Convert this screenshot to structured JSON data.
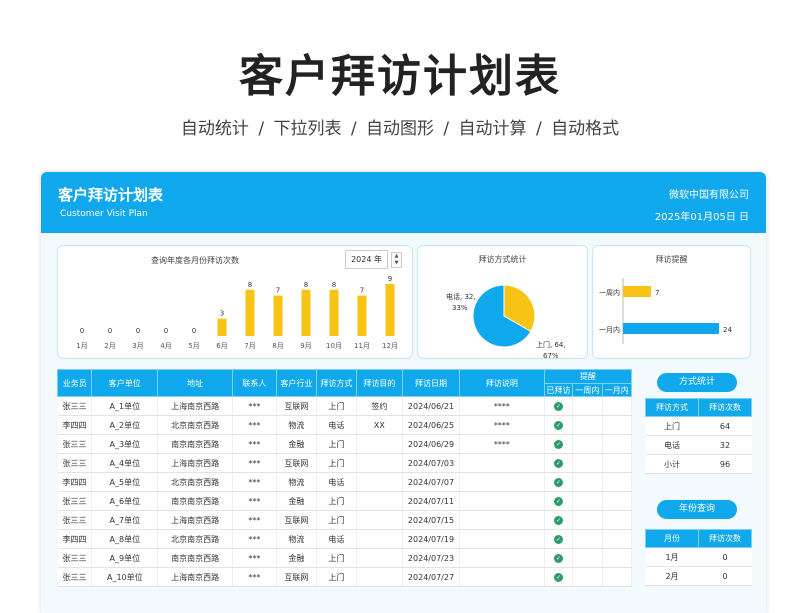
{
  "hero": {
    "title": "客户拜访计划表",
    "features": [
      "自动统计",
      "下拉列表",
      "自动图形",
      "自动计算",
      "自动格式"
    ],
    "separator": "/"
  },
  "header": {
    "title": "客户拜访计划表",
    "subtitle": "Customer Visit Plan",
    "company": "微软中国有限公司",
    "date": "2025年01月05日  日"
  },
  "monthly": {
    "title": "查询年度各月份拜访次数",
    "year_value": "2024 年",
    "spin_up": "▲",
    "spin_down": "▼"
  },
  "method_panel": {
    "title": "拜访方式统计"
  },
  "reminder_panel": {
    "title": "拜访提醒"
  },
  "chart_data": [
    {
      "type": "bar",
      "title": "查询年度各月份拜访次数",
      "categories": [
        "1月",
        "2月",
        "3月",
        "4月",
        "5月",
        "6月",
        "7月",
        "8月",
        "9月",
        "10月",
        "11月",
        "12月"
      ],
      "values": [
        0,
        0,
        0,
        0,
        0,
        3,
        8,
        7,
        8,
        8,
        7,
        9
      ],
      "ylim": [
        0,
        9
      ],
      "color": "#f7c315",
      "grid": false
    },
    {
      "type": "pie",
      "title": "拜访方式统计",
      "categories": [
        "电话",
        "上门"
      ],
      "values": [
        32,
        64
      ],
      "percent_labels": [
        "33%",
        "67%"
      ],
      "colors": [
        "#f7c315",
        "#0fa8ec"
      ]
    },
    {
      "type": "bar",
      "orientation": "horizontal",
      "title": "拜访提醒",
      "categories": [
        "一周内",
        "一月内"
      ],
      "values": [
        7,
        24
      ],
      "colors": [
        "#f7c315",
        "#0fa8ec"
      ]
    }
  ],
  "table": {
    "headers": [
      "业务员",
      "客户单位",
      "地址",
      "联系人",
      "客户行业",
      "拜访方式",
      "拜访目的",
      "拜访日期",
      "拜访说明"
    ],
    "reminder_header": "提醒",
    "reminder_sub": [
      "已拜访",
      "一周内",
      "一月内"
    ],
    "rows": [
      [
        "张三三",
        "A_1单位",
        "上海南京西路",
        "***",
        "互联网",
        "上门",
        "签约",
        "2024/06/21",
        "****"
      ],
      [
        "李四四",
        "A_2单位",
        "北京南京西路",
        "***",
        "物流",
        "电话",
        "XX",
        "2024/06/25",
        "****"
      ],
      [
        "张三三",
        "A_3单位",
        "南京南京西路",
        "***",
        "金融",
        "上门",
        "",
        "2024/06/29",
        "****"
      ],
      [
        "张三三",
        "A_4单位",
        "上海南京西路",
        "***",
        "互联网",
        "上门",
        "",
        "2024/07/03",
        ""
      ],
      [
        "李四四",
        "A_5单位",
        "北京南京西路",
        "***",
        "物流",
        "电话",
        "",
        "2024/07/07",
        ""
      ],
      [
        "张三三",
        "A_6单位",
        "南京南京西路",
        "***",
        "金融",
        "上门",
        "",
        "2024/07/11",
        ""
      ],
      [
        "张三三",
        "A_7单位",
        "上海南京西路",
        "***",
        "互联网",
        "上门",
        "",
        "2024/07/15",
        ""
      ],
      [
        "李四四",
        "A_8单位",
        "北京南京西路",
        "***",
        "物流",
        "电话",
        "",
        "2024/07/19",
        ""
      ],
      [
        "张三三",
        "A_9单位",
        "南京南京西路",
        "***",
        "金融",
        "上门",
        "",
        "2024/07/23",
        ""
      ],
      [
        "张三三",
        "A_10单位",
        "上海南京西路",
        "***",
        "互联网",
        "上门",
        "",
        "2024/07/27",
        ""
      ]
    ],
    "check_glyph": "✓"
  },
  "method_stats": {
    "button": "方式统计",
    "headers": [
      "拜访方式",
      "拜访次数"
    ],
    "rows": [
      [
        "上门",
        "64"
      ],
      [
        "电话",
        "32"
      ],
      [
        "小计",
        "96"
      ]
    ]
  },
  "year_query": {
    "button": "年份查询",
    "headers": [
      "月份",
      "拜访次数"
    ],
    "rows": [
      [
        "1月",
        "0"
      ],
      [
        "2月",
        "0"
      ]
    ]
  }
}
